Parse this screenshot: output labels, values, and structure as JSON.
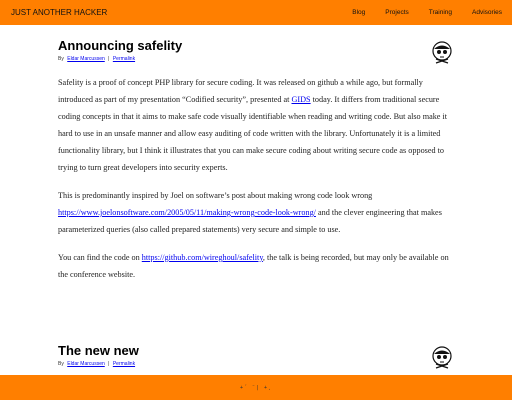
{
  "site": {
    "brand": "JUST ANOTHER HACKER",
    "nav": [
      "Blog",
      "Projects",
      "Training",
      "Advisories"
    ]
  },
  "posts": [
    {
      "title": "Announcing safelity",
      "by_prefix": "By",
      "author": "Eldar Marcussen",
      "separator": "|",
      "permalink": "Permalink",
      "avatar_icon": "skull-hacker-avatar-icon",
      "paragraphs": [
        {
          "parts": [
            {
              "text": "Safelity is a proof of concept PHP library for secure coding. It was released on github a while ago, but formally introduced as part of my presentation “Codified security”, presented at "
            },
            {
              "link": "GIDS"
            },
            {
              "text": " today. It differs from traditional secure coding concepts in that it aims to make safe code visually identifiable when reading and writing code. But also make it hard to use in an unsafe manner and allow easy auditing of code written with the library. Unfortunately it is a limited functionality library, but I think it illustrates that you can make secure coding about writing secure code as opposed to trying to turn great developers into security experts."
            }
          ]
        },
        {
          "parts": [
            {
              "text": "This is predominantly inspired by Joel on software’s post about making wrong code look wrong "
            },
            {
              "link": "https://www.joelonsoftware.com/2005/05/11/making-wrong-code-look-wrong/"
            },
            {
              "text": " and the clever engineering that makes parameterized queries (also called prepared statements) very secure and simple to use."
            }
          ]
        },
        {
          "parts": [
            {
              "text": "You can find the code on "
            },
            {
              "link": "https://github.com/wireghoul/safelity"
            },
            {
              "text": ", the talk is being recorded, but may only be available on the conference website."
            }
          ]
        }
      ]
    },
    {
      "title": "The new new",
      "by_prefix": "By",
      "author": "Eldar Marcussen",
      "separator": "|",
      "permalink": "Permalink",
      "avatar_icon": "skull-hacker-avatar-icon"
    }
  ],
  "footer": {
    "glyphs": "+´ ¨| +¸",
    "accent_color": "#ff7f00"
  }
}
